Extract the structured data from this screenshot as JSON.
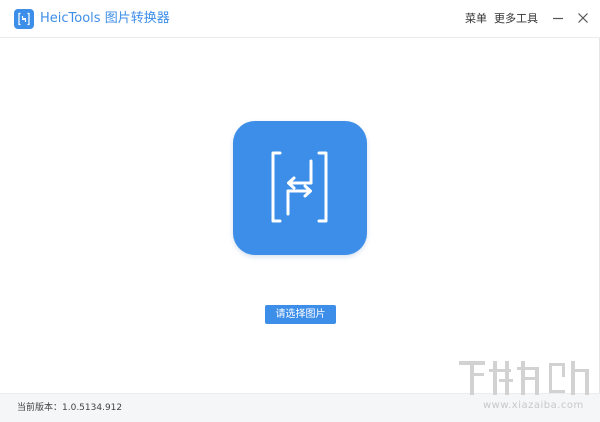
{
  "window": {
    "app_title": "HeicTools 图片转换器",
    "menu_label": "菜单",
    "more_tools_label": "更多工具"
  },
  "main": {
    "logo_icon": "heic-tools-logo-icon",
    "select_button_label": "请选择图片"
  },
  "status_bar": {
    "version_text": "当前版本：1.0.5134.912"
  },
  "watermark": {
    "domain": "www.xiazaiba.com"
  },
  "colors": {
    "accent": "#3d8ee8",
    "status_bar_bg": "#f5f6f8"
  }
}
